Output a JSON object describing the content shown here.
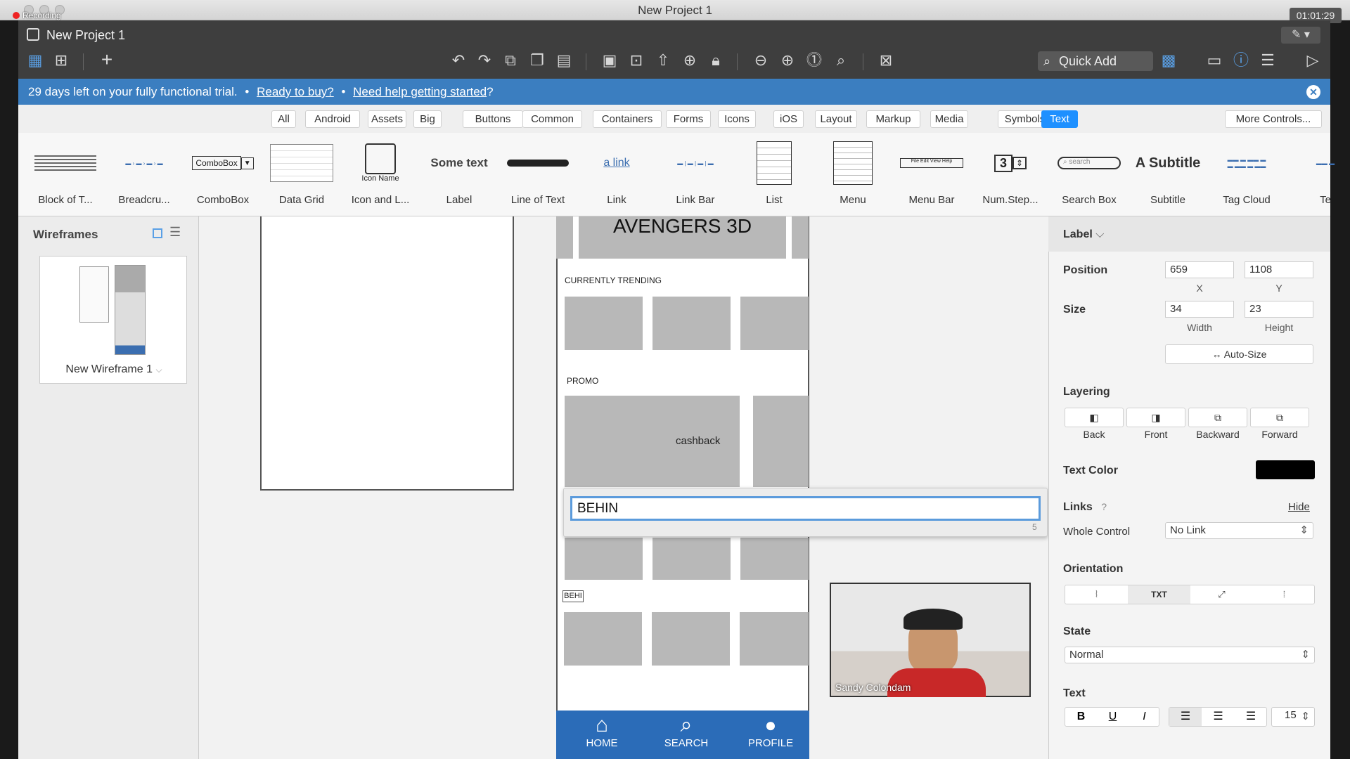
{
  "window": {
    "title": "New Project 1",
    "recording": "Recording",
    "timer": "01:01:29"
  },
  "app": {
    "project_title": "New Project 1",
    "quick_add": "Quick Add"
  },
  "trial": {
    "text": "29 days left on your fully functional trial.",
    "sep1": "•",
    "buy": "Ready to buy?",
    "sep2": "•",
    "help": "Need help getting started",
    "q": "?"
  },
  "categories": [
    "All",
    "Android",
    "Assets",
    "Big",
    "Buttons",
    "Common",
    "Containers",
    "Forms",
    "Icons",
    "iOS",
    "Layout",
    "Markup",
    "Media",
    "Symbols",
    "Text"
  ],
  "more_controls": "More Controls...",
  "library": {
    "items": [
      "Block of T...",
      "Breadcru...",
      "ComboBox",
      "Data Grid",
      "Icon and L...",
      "Label",
      "Line of Text",
      "Link",
      "Link Bar",
      "List",
      "Menu",
      "Menu Bar",
      "Num.Step...",
      "Search Box",
      "Subtitle",
      "Tag Cloud",
      "Te"
    ],
    "combobox_thumb": "ComboBox",
    "icon_thumb": "Icon Name",
    "label_thumb": "Some text",
    "link_thumb": "a link",
    "numstep_thumb": "3",
    "search_thumb": "search",
    "subtitle_thumb": "A Subtitle"
  },
  "wireframes": {
    "title": "Wireframes",
    "item": "New Wireframe 1"
  },
  "mockup": {
    "header": "AVENGERS 3D",
    "trending": "CURRENTLY TRENDING",
    "promo": "PROMO",
    "cashback": "cashback",
    "small_label": "BEHI",
    "nav": [
      "HOME",
      "SEARCH",
      "PROFILE"
    ]
  },
  "editor": {
    "value": "BEHIN",
    "count": "5"
  },
  "video": {
    "name": "Sandy Colondam"
  },
  "props": {
    "type": "Label",
    "position_label": "Position",
    "x": "659",
    "y": "1108",
    "x_lbl": "X",
    "y_lbl": "Y",
    "size_label": "Size",
    "w": "34",
    "h": "23",
    "w_lbl": "Width",
    "h_lbl": "Height",
    "autosize": "Auto-Size",
    "layering": "Layering",
    "layer_btns": [
      "Back",
      "Front",
      "Backward",
      "Forward"
    ],
    "text_color": "Text Color",
    "color": "#000000",
    "links": "Links",
    "links_q": "?",
    "hide": "Hide",
    "whole_control": "Whole Control",
    "no_link": "No Link",
    "orientation": "Orientation",
    "orient_txt": "TXT",
    "state": "State",
    "state_val": "Normal",
    "text": "Text",
    "font_size": "15"
  }
}
